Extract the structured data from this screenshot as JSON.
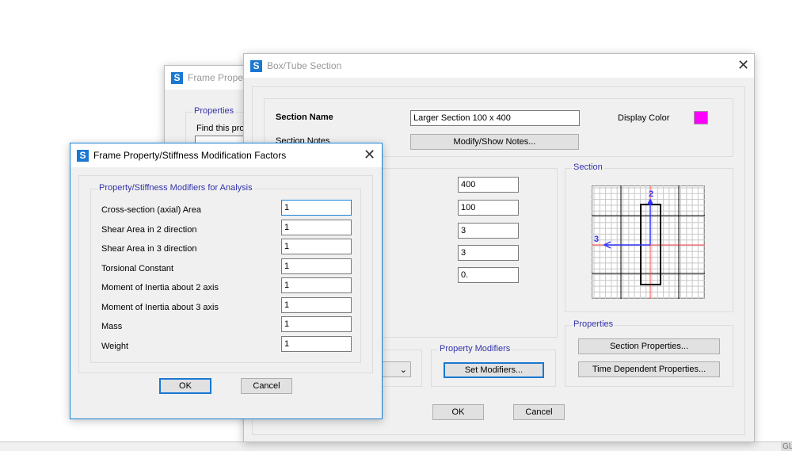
{
  "back_window": {
    "title": "Frame Proper",
    "group_label": "Properties",
    "find_label": "Find this prop"
  },
  "box_window": {
    "title": "Box/Tube Section",
    "section_name_label": "Section Name",
    "section_name_value": "Larger Section 100 x 400",
    "display_color_label": "Display Color",
    "display_color": "#ff00ff",
    "section_notes_label": "Section Notes",
    "modify_notes_button": "Modify/Show Notes...",
    "dimensions": [
      "400",
      "100",
      "3",
      "3",
      "0."
    ],
    "section_group_label": "Section",
    "axis_2_label": "2",
    "axis_3_label": "3",
    "properties_group_label": "Properties",
    "section_properties_button": "Section Properties...",
    "time_dependent_button": "Time Dependent Properties...",
    "property_modifiers_label": "Property Modifiers",
    "set_modifiers_button": "Set Modifiers...",
    "ok": "OK",
    "cancel": "Cancel"
  },
  "modifiers_dialog": {
    "title": "Frame Property/Stiffness Modification Factors",
    "group_label": "Property/Stiffness Modifiers for Analysis",
    "rows": [
      {
        "label": "Cross-section (axial) Area",
        "value": "1"
      },
      {
        "label": "Shear Area in 2 direction",
        "value": "1"
      },
      {
        "label": "Shear Area in 3 direction",
        "value": "1"
      },
      {
        "label": "Torsional Constant",
        "value": "1"
      },
      {
        "label": "Moment of Inertia about 2 axis",
        "value": "1"
      },
      {
        "label": "Moment of Inertia about 3 axis",
        "value": "1"
      },
      {
        "label": "Mass",
        "value": "1"
      },
      {
        "label": "Weight",
        "value": "1"
      }
    ],
    "ok": "OK",
    "cancel": "Cancel"
  },
  "taskbar": {
    "corner_text": "GL"
  }
}
